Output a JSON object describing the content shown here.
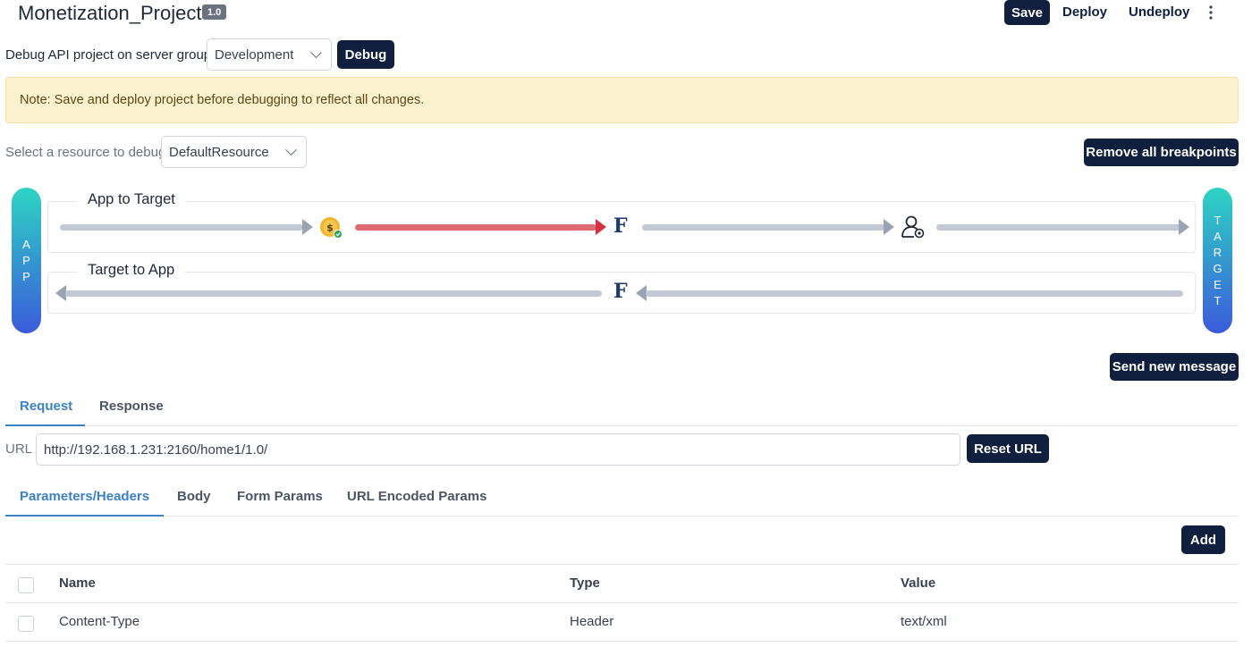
{
  "header": {
    "project_name": "Monetization_Project",
    "version_badge": "1.0",
    "save_label": "Save",
    "deploy_label": "Deploy",
    "undeploy_label": "Undeploy"
  },
  "debug_bar": {
    "label": "Debug API project on server group",
    "server_group": "Development",
    "debug_label": "Debug"
  },
  "note": "Note: Save and deploy project before debugging to reflect all changes.",
  "resource": {
    "label": "Select a resource to debug",
    "selected": "DefaultResource",
    "remove_breakpoints_label": "Remove all breakpoints"
  },
  "flow": {
    "app_label": [
      "A",
      "P",
      "P"
    ],
    "target_label": [
      "T",
      "A",
      "R",
      "G",
      "E",
      "T"
    ],
    "app_to_target_title": "App to Target",
    "target_to_app_title": "Target to App",
    "icons": [
      "monetization-coin-icon",
      "function-f-icon",
      "user-gear-icon",
      "function-f-icon"
    ],
    "colors": {
      "breakpoint": "#d6303c",
      "line": "#c3c9d4",
      "pill_top": "#2dd4c3",
      "pill_bottom": "#3b5bdb"
    }
  },
  "send_new_message_label": "Send new message",
  "tabs": {
    "request": "Request",
    "response": "Response"
  },
  "url": {
    "label": "URL",
    "value": "http://192.168.1.231:2160/home1/1.0/",
    "reset_label": "Reset URL"
  },
  "subtabs": {
    "params_headers": "Parameters/Headers",
    "body": "Body",
    "form_params": "Form Params",
    "url_encoded": "URL Encoded Params"
  },
  "add_label": "Add",
  "table": {
    "headers": {
      "name": "Name",
      "type": "Type",
      "value": "Value"
    },
    "rows": [
      {
        "name": "Content-Type",
        "type": "Header",
        "value": "text/xml"
      }
    ]
  }
}
